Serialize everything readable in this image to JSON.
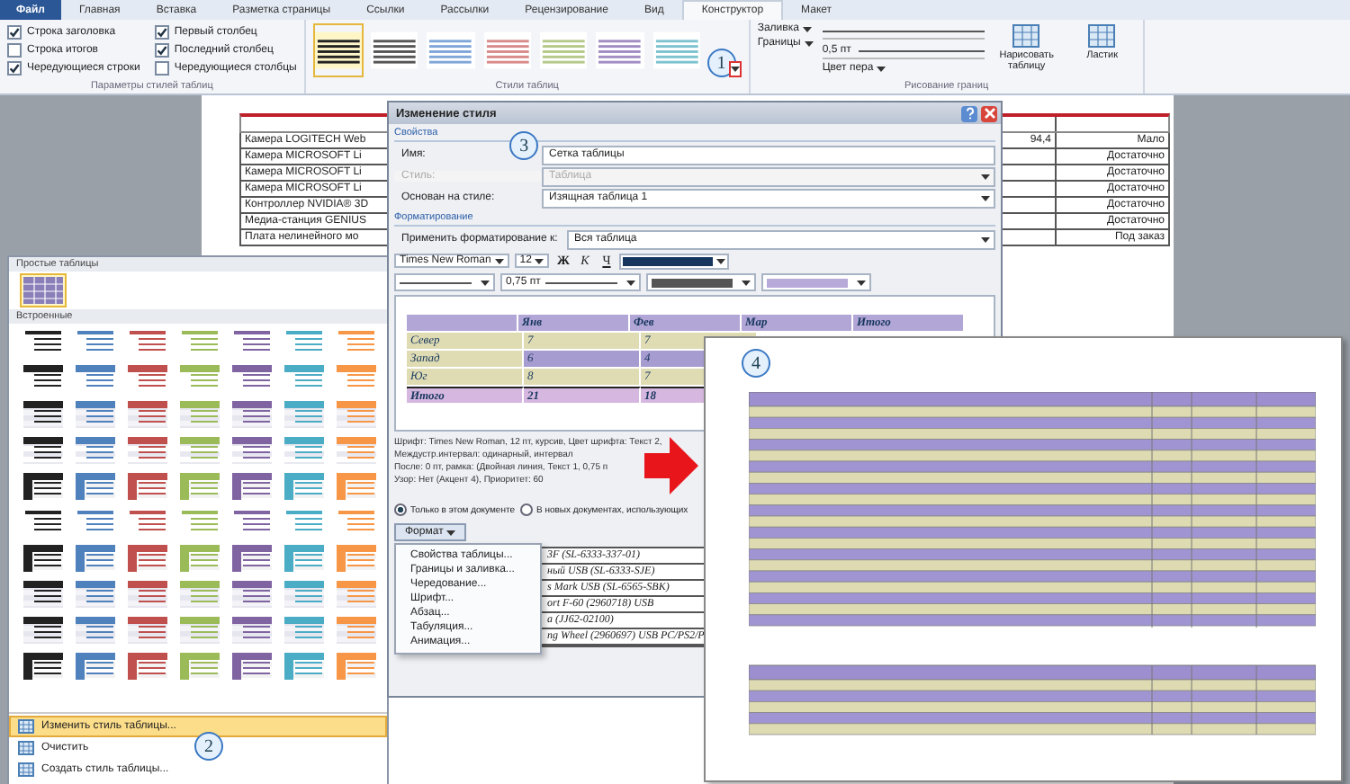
{
  "ribbon": {
    "tabs": [
      {
        "label": "Файл",
        "kind": "file",
        "selected": false
      },
      {
        "label": "Главная",
        "kind": "tab",
        "selected": false
      },
      {
        "label": "Вставка",
        "kind": "tab",
        "selected": false
      },
      {
        "label": "Разметка страницы",
        "kind": "tab",
        "selected": false
      },
      {
        "label": "Ссылки",
        "kind": "tab",
        "selected": false
      },
      {
        "label": "Рассылки",
        "kind": "tab",
        "selected": false
      },
      {
        "label": "Рецензирование",
        "kind": "tab",
        "selected": false
      },
      {
        "label": "Вид",
        "kind": "tab",
        "selected": false
      },
      {
        "label": "Конструктор",
        "kind": "tab",
        "selected": true
      },
      {
        "label": "Макет",
        "kind": "tab",
        "selected": false
      }
    ],
    "options": {
      "title": "Параметры стилей таблиц",
      "items": [
        {
          "label": "Строка заголовка",
          "checked": true
        },
        {
          "label": "Строка итогов",
          "checked": false
        },
        {
          "label": "Чередующиеся строки",
          "checked": true
        },
        {
          "label": "Первый столбец",
          "checked": true
        },
        {
          "label": "Последний столбец",
          "checked": true
        },
        {
          "label": "Чередующиеся столбцы",
          "checked": false
        }
      ]
    },
    "styles": {
      "title": "Стили таблиц",
      "badge": "1",
      "items": [
        {
          "color": "#222222",
          "selected": true
        },
        {
          "color": "#555555",
          "selected": false
        },
        {
          "color": "#7fa6d8",
          "selected": false
        },
        {
          "color": "#d98a8a",
          "selected": false
        },
        {
          "color": "#b5c98a",
          "selected": false
        },
        {
          "color": "#a18cc4",
          "selected": false
        },
        {
          "color": "#7cc3cf",
          "selected": false
        }
      ]
    },
    "borders": {
      "title": "Рисование границ",
      "shading": "Заливка",
      "borders": "Границы",
      "pen_weight": "0,5 пт",
      "pen_color": "Цвет пера",
      "draw_table": "Нарисовать таблицу",
      "eraser": "Ластик"
    }
  },
  "document": {
    "rows": [
      {
        "name": "Камера LOGITECH Web",
        "price": "94,4",
        "stock": "Мало"
      },
      {
        "name": "Камера MICROSOFT Li",
        "stock": "Достаточно"
      },
      {
        "name": "Камера MICROSOFT Li",
        "stock": "Достаточно"
      },
      {
        "name": "Камера MICROSOFT Li",
        "stock": "Достаточно"
      },
      {
        "name": "Контроллер NVIDIA® 3D",
        "stock": "Достаточно"
      },
      {
        "name": "Медиа-станция GENIUS",
        "stock": "Достаточно"
      },
      {
        "name": "Плата нелинейного мо",
        "stock": "Под заказ"
      }
    ],
    "fragment_rows": [
      "3F (SL-6333-337-01)",
      "ный USB (SL-6333-SJE)",
      "s Mark USB (SL-6565-SBK)",
      "ort F-60 (2960718) USB",
      "a (JJ62-02100)",
      "ng Wheel (2960697) USB PC/PS2/P"
    ]
  },
  "gallery": {
    "simple_title": "Простые таблицы",
    "builtin_title": "Встроенные",
    "badge": "2",
    "colors": [
      {
        "color": "#222222"
      },
      {
        "color": "#4f81bd"
      },
      {
        "color": "#c0504d"
      },
      {
        "color": "#9bbb59"
      },
      {
        "color": "#8064a2"
      },
      {
        "color": "#4bacc6"
      },
      {
        "color": "#f79646"
      }
    ],
    "rows": [
      {
        "kind": "lines"
      },
      {
        "kind": "header"
      },
      {
        "kind": "shaded"
      },
      {
        "kind": "banded"
      },
      {
        "kind": "firstcol"
      },
      {
        "kind": "lines"
      },
      {
        "kind": "firstcol"
      },
      {
        "kind": "shaded"
      },
      {
        "kind": "shaded"
      },
      {
        "kind": "firstcol"
      }
    ],
    "actions": [
      {
        "label": "Изменить стиль таблицы...",
        "selected": true
      },
      {
        "label": "Очистить",
        "selected": false
      },
      {
        "label": "Создать стиль таблицы...",
        "selected": false
      }
    ]
  },
  "dialog": {
    "title": "Изменение стиля",
    "badge": "3",
    "properties_title": "Свойства",
    "fields": [
      {
        "label": "Имя:",
        "value": "Сетка таблицы",
        "kind": "text",
        "disabled": false
      },
      {
        "label": "Стиль:",
        "value": "Таблица",
        "kind": "select",
        "disabled": true
      },
      {
        "label": "Основан на стиле:",
        "value": "Изящная таблица 1",
        "kind": "select",
        "disabled": false
      }
    ],
    "formatting_title": "Форматирование",
    "apply_label": "Применить форматирование к:",
    "apply_value": "Вся таблица",
    "font": "Times New Roman",
    "size": "12",
    "bold": "Ж",
    "italic": "К",
    "underline": "Ч",
    "line_width": "0,75 пт",
    "preview": {
      "header": [
        "Янв",
        "Фев",
        "Мар",
        "Итого"
      ],
      "rows": [
        [
          "Север",
          "7",
          "7"
        ],
        [
          "Запад",
          "6",
          "4"
        ],
        [
          "Юг",
          "8",
          "7"
        ],
        [
          "Итого",
          "21",
          "18"
        ]
      ]
    },
    "description": "Шрифт: Times New Roman, 12 пт, курсив, Цвет шрифта: Текст 2,\nМеждустр.интервал:  одинарный, интервал\nПосле:  0 пт, рамка: (Двойная линия, Текст 1,  0,75 п\nУзор: Нет (Акцент 4), Приоритет: 60",
    "scope": [
      {
        "label": "Только в этом документе",
        "selected": true
      },
      {
        "label": "В новых документах, использующих",
        "selected": false
      }
    ],
    "format_button": "Формат",
    "format_menu": [
      "Свойства таблицы...",
      "Границы и заливка...",
      "Чередование...",
      "Шрифт...",
      "Абзац...",
      "Табуляция...",
      "Анимация..."
    ]
  },
  "preview": {
    "badge": "4"
  }
}
